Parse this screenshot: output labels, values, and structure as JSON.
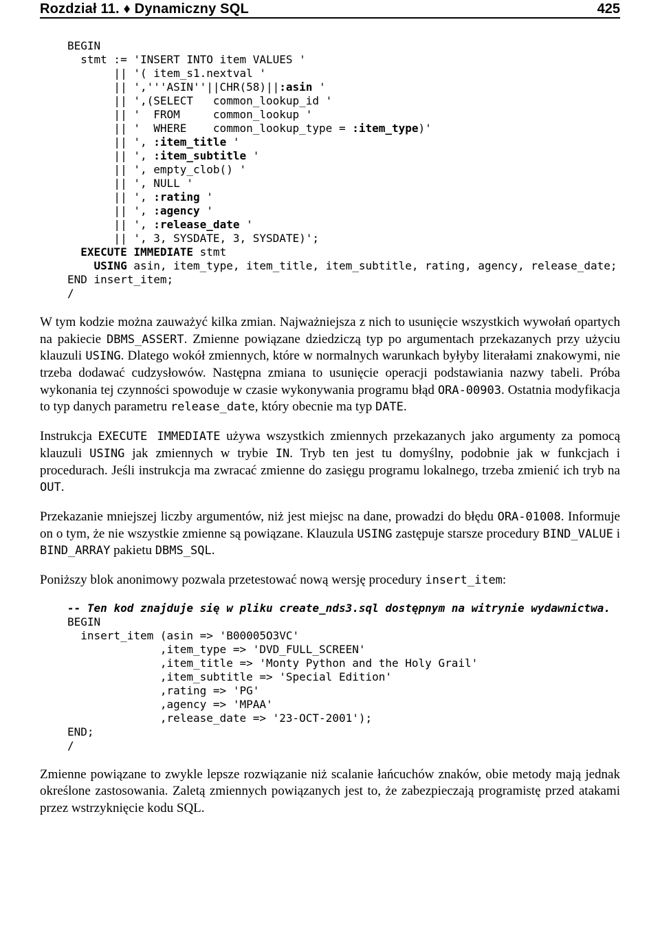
{
  "header": {
    "left": "Rozdział 11. ♦ Dynamiczny SQL",
    "page_number": "425"
  },
  "code1": {
    "l01": "BEGIN",
    "l02": "  stmt := 'INSERT INTO item VALUES '",
    "l03": "       || '( item_s1.nextval '",
    "l04a": "       || ','''ASIN''||CHR(58)||",
    "l04b": ":asin",
    "l04c": " '",
    "l05": "       || ',(SELECT   common_lookup_id '",
    "l06": "       || '  FROM     common_lookup '",
    "l07a": "       || '  WHERE    common_lookup_type = ",
    "l07b": ":item_type",
    "l07c": ")'",
    "l08a": "       || ', ",
    "l08b": ":item_title",
    "l08c": " '",
    "l09a": "       || ', ",
    "l09b": ":item_subtitle",
    "l09c": " '",
    "l10": "       || ', empty_clob() '",
    "l11": "       || ', NULL '",
    "l12a": "       || ', ",
    "l12b": ":rating",
    "l12c": " '",
    "l13a": "       || ', ",
    "l13b": ":agency",
    "l13c": " '",
    "l14a": "       || ', ",
    "l14b": ":release_date",
    "l14c": " '",
    "l15": "       || ', 3, SYSDATE, 3, SYSDATE)';",
    "l16a": "  ",
    "l16b": "EXECUTE IMMEDIATE",
    "l16c": " stmt",
    "l17a": "    ",
    "l17b": "USING",
    "l17c": " asin, item_type, item_title, item_subtitle, rating, agency, release_date;",
    "l18": "END insert_item;",
    "l19": "/"
  },
  "p1": {
    "t01": "W tym kodzie można zauważyć kilka zmian. Najważniejsza z nich to usunięcie wszystkich wywołań opartych na pakiecie ",
    "m01": "DBMS_ASSERT",
    "t02": ". Zmienne powiązane dziedziczą typ po argumentach przekazanych przy użyciu klauzuli ",
    "m02": "USING",
    "t03": ". Dlatego wokół zmiennych, które w normalnych warunkach byłyby literałami znakowymi, nie trzeba dodawać cudzysłowów. Następna zmiana to usunięcie operacji podstawiania nazwy tabeli. Próba wykonania tej czynności spowoduje w czasie wykonywania programu błąd ",
    "m03": "ORA-00903",
    "t04": ". Ostatnia modyfikacja to typ danych parametru ",
    "m04": "release_date",
    "t05": ", który obecnie ma typ ",
    "m05": "DATE",
    "t06": "."
  },
  "p2": {
    "t01": "Instrukcja ",
    "m01": "EXECUTE IMMEDIATE",
    "t02": " używa wszystkich zmiennych przekazanych jako argumenty za pomocą klauzuli ",
    "m02": "USING",
    "t03": " jak zmiennych w trybie ",
    "m03": "IN",
    "t04": ". Tryb ten jest tu domyślny, podobnie jak w funkcjach i procedurach. Jeśli instrukcja ma zwracać zmienne do zasięgu programu lokalnego, trzeba zmienić ich tryb na ",
    "m04": "OUT",
    "t05": "."
  },
  "p3": {
    "t01": "Przekazanie mniejszej liczby argumentów, niż jest miejsc na dane, prowadzi do błędu ",
    "m01": "ORA-01008",
    "t02": ". Informuje on o tym, że nie wszystkie zmienne są powiązane. Klauzula ",
    "m02": "USING",
    "t03": " zastępuje starsze procedury ",
    "m03": "BIND_VALUE",
    "t04": " i ",
    "m04": "BIND_ARRAY",
    "t05": " pakietu ",
    "m05": "DBMS_SQL",
    "t06": "."
  },
  "p4": {
    "t01": "Poniższy blok anonimowy pozwala przetestować nową wersję procedury ",
    "m01": "insert_item",
    "t02": ":"
  },
  "code2": {
    "l01": "-- Ten kod znajduje się w pliku create_nds3.sql dostępnym na witrynie wydawnictwa.",
    "l02": "BEGIN",
    "l03": "  insert_item (asin => 'B00005O3VC'",
    "l04": "              ,item_type => 'DVD_FULL_SCREEN'",
    "l05": "              ,item_title => 'Monty Python and the Holy Grail'",
    "l06": "              ,item_subtitle => 'Special Edition'",
    "l07": "              ,rating => 'PG'",
    "l08": "              ,agency => 'MPAA'",
    "l09": "              ,release_date => '23-OCT-2001');",
    "l10": "END;",
    "l11": "/"
  },
  "p5": {
    "t01": "Zmienne powiązane to zwykle lepsze rozwiązanie niż scalanie łańcuchów znaków, obie metody mają jednak określone zastosowania. Zaletą zmiennych powiązanych jest to, że zabezpieczają programistę przed atakami przez wstrzyknięcie kodu SQL."
  }
}
